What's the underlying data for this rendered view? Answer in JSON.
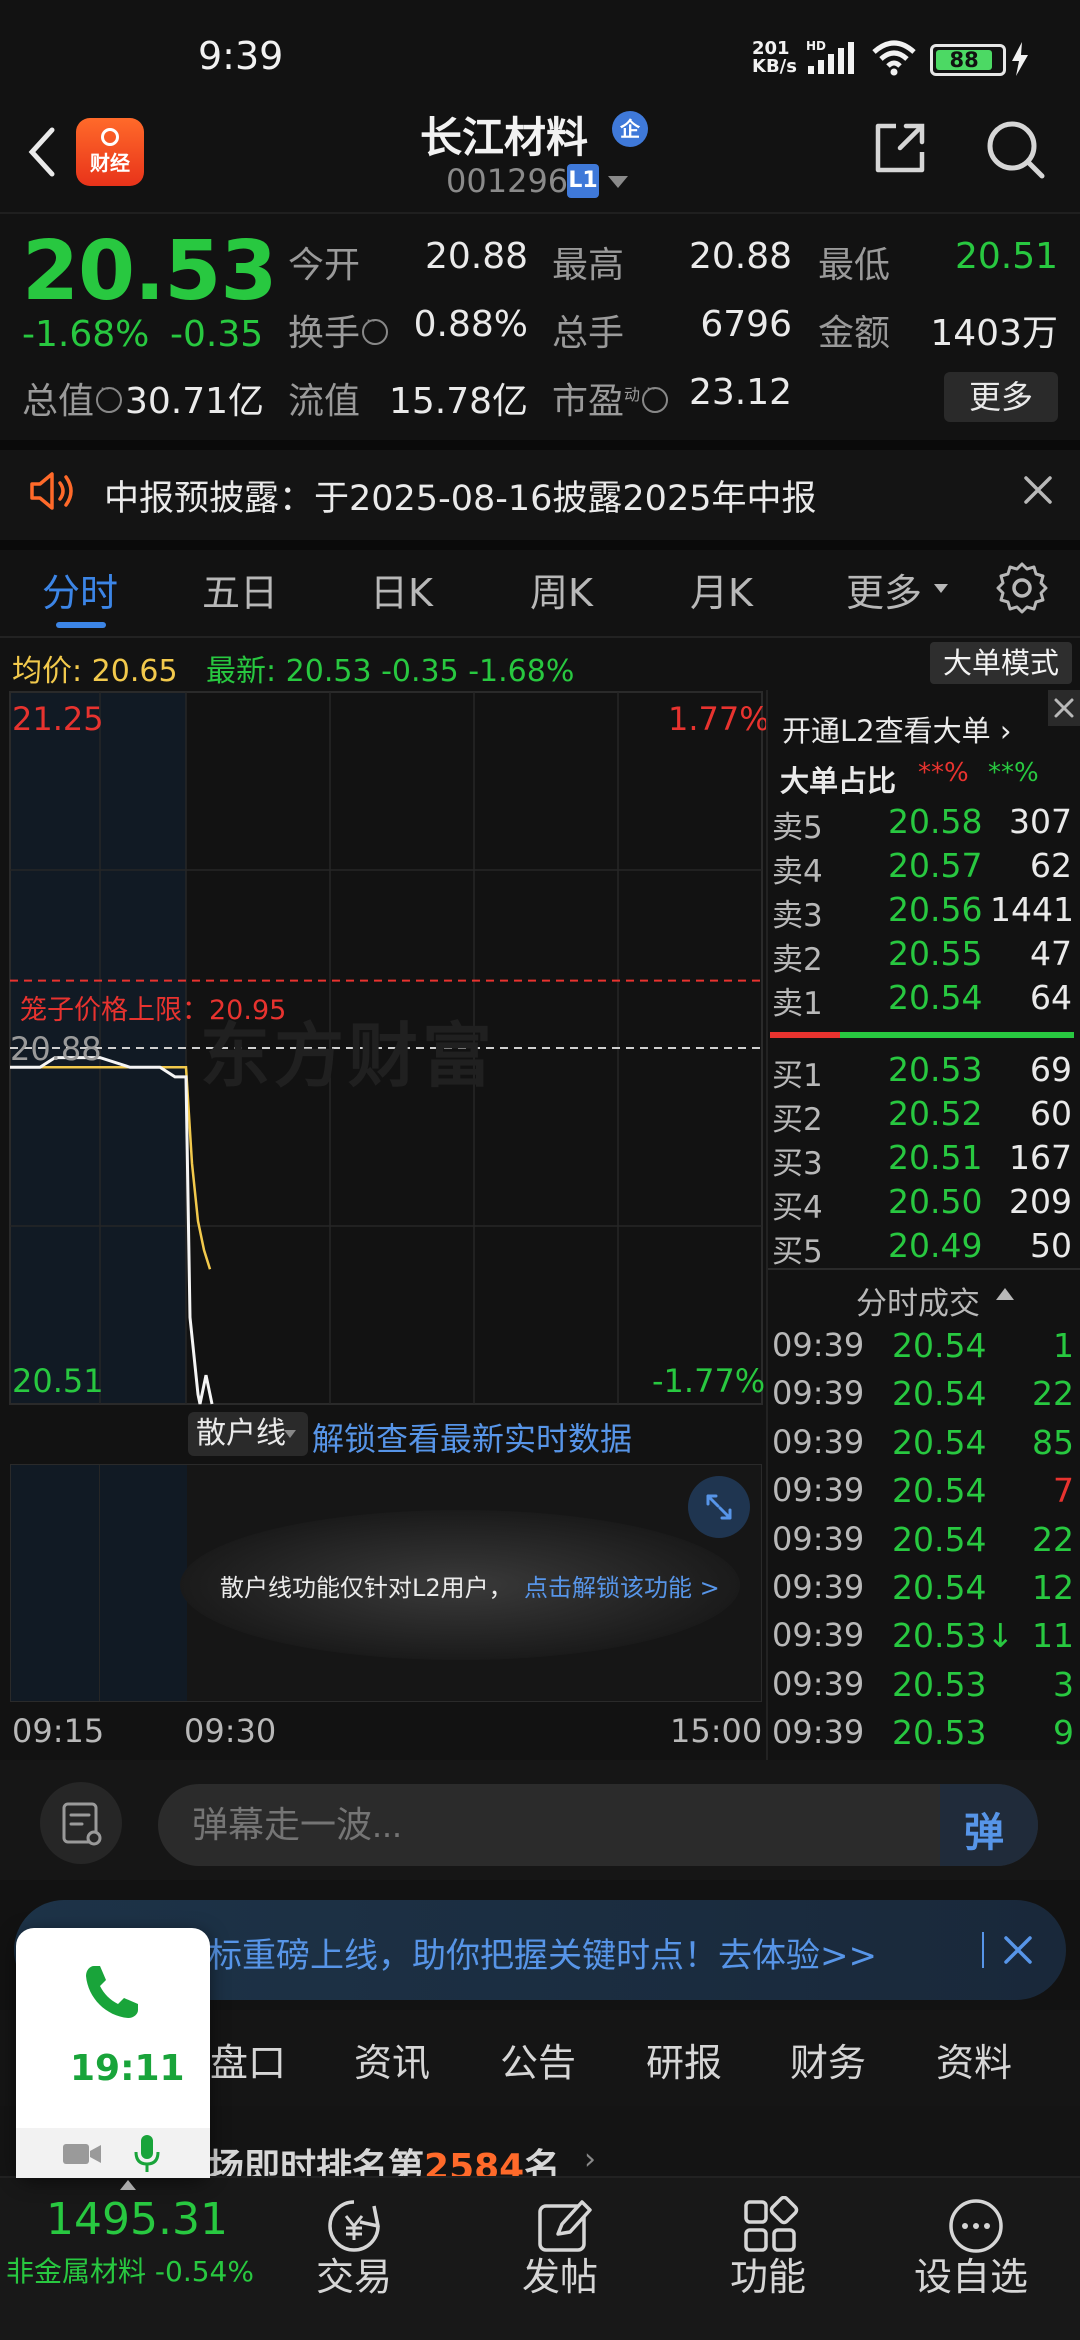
{
  "status_bar": {
    "time": "9:39",
    "net_speed_value": "201",
    "net_speed_unit": "KB/s",
    "network": "HD",
    "battery": "88",
    "battery_level": 0.88
  },
  "header": {
    "stock_name": "长江材料",
    "name_badge": "企",
    "stock_code": "001296",
    "level_badge": "L1",
    "logo_text": "财经"
  },
  "quote": {
    "last_price": "20.53",
    "change_pct": "-1.68%",
    "change_amt": "-0.35",
    "open_label": "今开",
    "open": "20.88",
    "high_label": "最高",
    "high": "20.88",
    "low_label": "最低",
    "low": "20.51",
    "turnover_label": "换手",
    "turnover": "0.88%",
    "volume_label": "总手",
    "volume": "6796",
    "amount_label": "金额",
    "amount": "1403万",
    "mktcap_label": "总值",
    "mktcap": "30.71亿",
    "float_label": "流值",
    "float_cap": "15.78亿",
    "pe_label": "市盈",
    "pe_sup": "动",
    "pe": "23.12",
    "more_label": "更多"
  },
  "notice": {
    "text": "中报预披露：于2025-08-16披露2025年中报"
  },
  "tabs": [
    {
      "label": "分时",
      "active": true
    },
    {
      "label": "五日"
    },
    {
      "label": "日K"
    },
    {
      "label": "周K"
    },
    {
      "label": "月K"
    },
    {
      "label": "更多"
    }
  ],
  "info_line": {
    "avg": "均价: 20.65",
    "latest": "最新: 20.53  -0.35  -1.68%",
    "mode_btn": "大单模式"
  },
  "chart_axes": {
    "high": "21.25",
    "high_pct": "1.77%",
    "open": "20.88",
    "low": "20.51",
    "low_pct": "-1.77%",
    "cage_label": "笼子价格上限：20.95",
    "watermark": "东方财富",
    "times": [
      "09:15",
      "09:30",
      "15:00"
    ]
  },
  "chart_data": {
    "type": "line",
    "ylim": [
      20.51,
      21.25
    ],
    "reference_price": 20.88,
    "cage_upper": 20.95,
    "series": [
      {
        "name": "最新",
        "values": [
          20.86,
          20.86,
          20.87,
          20.87,
          20.87,
          20.86,
          20.86,
          20.85,
          20.85,
          20.6,
          20.56,
          20.52,
          20.51,
          20.54,
          20.51
        ]
      },
      {
        "name": "均价",
        "values": [
          20.86,
          20.86,
          20.86,
          20.86,
          20.86,
          20.86,
          20.86,
          20.86,
          20.86,
          20.76,
          20.7,
          20.67,
          20.65
        ]
      }
    ]
  },
  "retail": {
    "select_label": "散户线",
    "unlock_link": "解锁查看最新实时数据",
    "panel_text": "散户线功能仅针对L2用户，",
    "panel_link": "点击解锁该功能 >"
  },
  "order_book": {
    "l2_link": "开通L2查看大单 ›",
    "ratio_label": "大单占比",
    "ratio_red": "**%",
    "ratio_green": "**%",
    "asks": [
      {
        "label": "卖5",
        "price": "20.58",
        "vol": "307"
      },
      {
        "label": "卖4",
        "price": "20.57",
        "vol": "62"
      },
      {
        "label": "卖3",
        "price": "20.56",
        "vol": "1441"
      },
      {
        "label": "卖2",
        "price": "20.55",
        "vol": "47"
      },
      {
        "label": "卖1",
        "price": "20.54",
        "vol": "64"
      }
    ],
    "bids": [
      {
        "label": "买1",
        "price": "20.53",
        "vol": "69"
      },
      {
        "label": "买2",
        "price": "20.52",
        "vol": "60"
      },
      {
        "label": "买3",
        "price": "20.51",
        "vol": "167"
      },
      {
        "label": "买4",
        "price": "20.50",
        "vol": "209"
      },
      {
        "label": "买5",
        "price": "20.49",
        "vol": "50"
      }
    ],
    "ticks_title": "分时成交",
    "ticks": [
      {
        "time": "09:39",
        "price": "20.54",
        "vol": "1",
        "color": "#28c840"
      },
      {
        "time": "09:39",
        "price": "20.54",
        "vol": "22",
        "color": "#28c840"
      },
      {
        "time": "09:39",
        "price": "20.54",
        "vol": "85",
        "color": "#28c840"
      },
      {
        "time": "09:39",
        "price": "20.54",
        "vol": "7",
        "color": "#e8332f"
      },
      {
        "time": "09:39",
        "price": "20.54",
        "vol": "22",
        "color": "#28c840"
      },
      {
        "time": "09:39",
        "price": "20.54",
        "vol": "12",
        "color": "#28c840"
      },
      {
        "time": "09:39",
        "price": "20.53↓",
        "vol": "11",
        "color": "#28c840"
      },
      {
        "time": "09:39",
        "price": "20.53",
        "vol": "3",
        "color": "#28c840"
      },
      {
        "time": "09:39",
        "price": "20.53",
        "vol": "9",
        "color": "#28c840"
      }
    ]
  },
  "comment": {
    "placeholder": "弹幕走一波...",
    "send_label": "弹"
  },
  "promo": {
    "text": "标重磅上线，助你把握关键时点！去体验>>"
  },
  "lower_tabs": [
    "盘口",
    "资讯",
    "公告",
    "研报",
    "财务",
    "资料"
  ],
  "rank": {
    "prefix": "场即时排名第",
    "number": "2584",
    "suffix": "名"
  },
  "bottom_nav": {
    "index_value": "1495.31",
    "index_name": "非金属材料 -0.54%",
    "items": [
      {
        "label": "交易"
      },
      {
        "label": "发帖"
      },
      {
        "label": "功能"
      },
      {
        "label": "设自选"
      }
    ]
  },
  "call_widget": {
    "time": "19:11"
  }
}
